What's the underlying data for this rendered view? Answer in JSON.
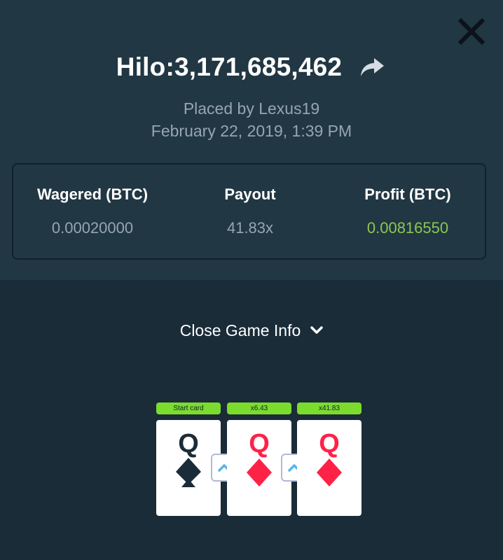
{
  "header": {
    "title": "Hilo:3,171,685,462",
    "placed_by": "Placed by Lexus19",
    "date": "February 22, 2019, 1:39 PM"
  },
  "icons": {
    "close": "close-icon",
    "share": "share-arrow-icon",
    "chevron": "chevron-down-icon",
    "higher": "arrow-up-icon"
  },
  "stats": {
    "wagered_label": "Wagered (BTC)",
    "wagered_value": "0.00020000",
    "payout_label": "Payout",
    "payout_value": "41.83x",
    "profit_label": "Profit (BTC)",
    "profit_value": "0.00816550"
  },
  "game_info": {
    "label": "Close Game Info"
  },
  "cards": [
    {
      "badge": "Start card",
      "rank": "Q",
      "suit": "spades",
      "color": "#1a2c38"
    },
    {
      "badge": "x6.43",
      "rank": "Q",
      "suit": "diamonds",
      "color": "#fe2247"
    },
    {
      "badge": "x41.83",
      "rank": "Q",
      "suit": "diamonds",
      "color": "#fe2247"
    }
  ],
  "colors": {
    "top_bg": "#213743",
    "bottom_bg": "#1a2c38",
    "profit": "#8cc751",
    "badge": "#7bdc2e",
    "red_suit": "#fe2247",
    "arrow": "#58b5e8"
  }
}
